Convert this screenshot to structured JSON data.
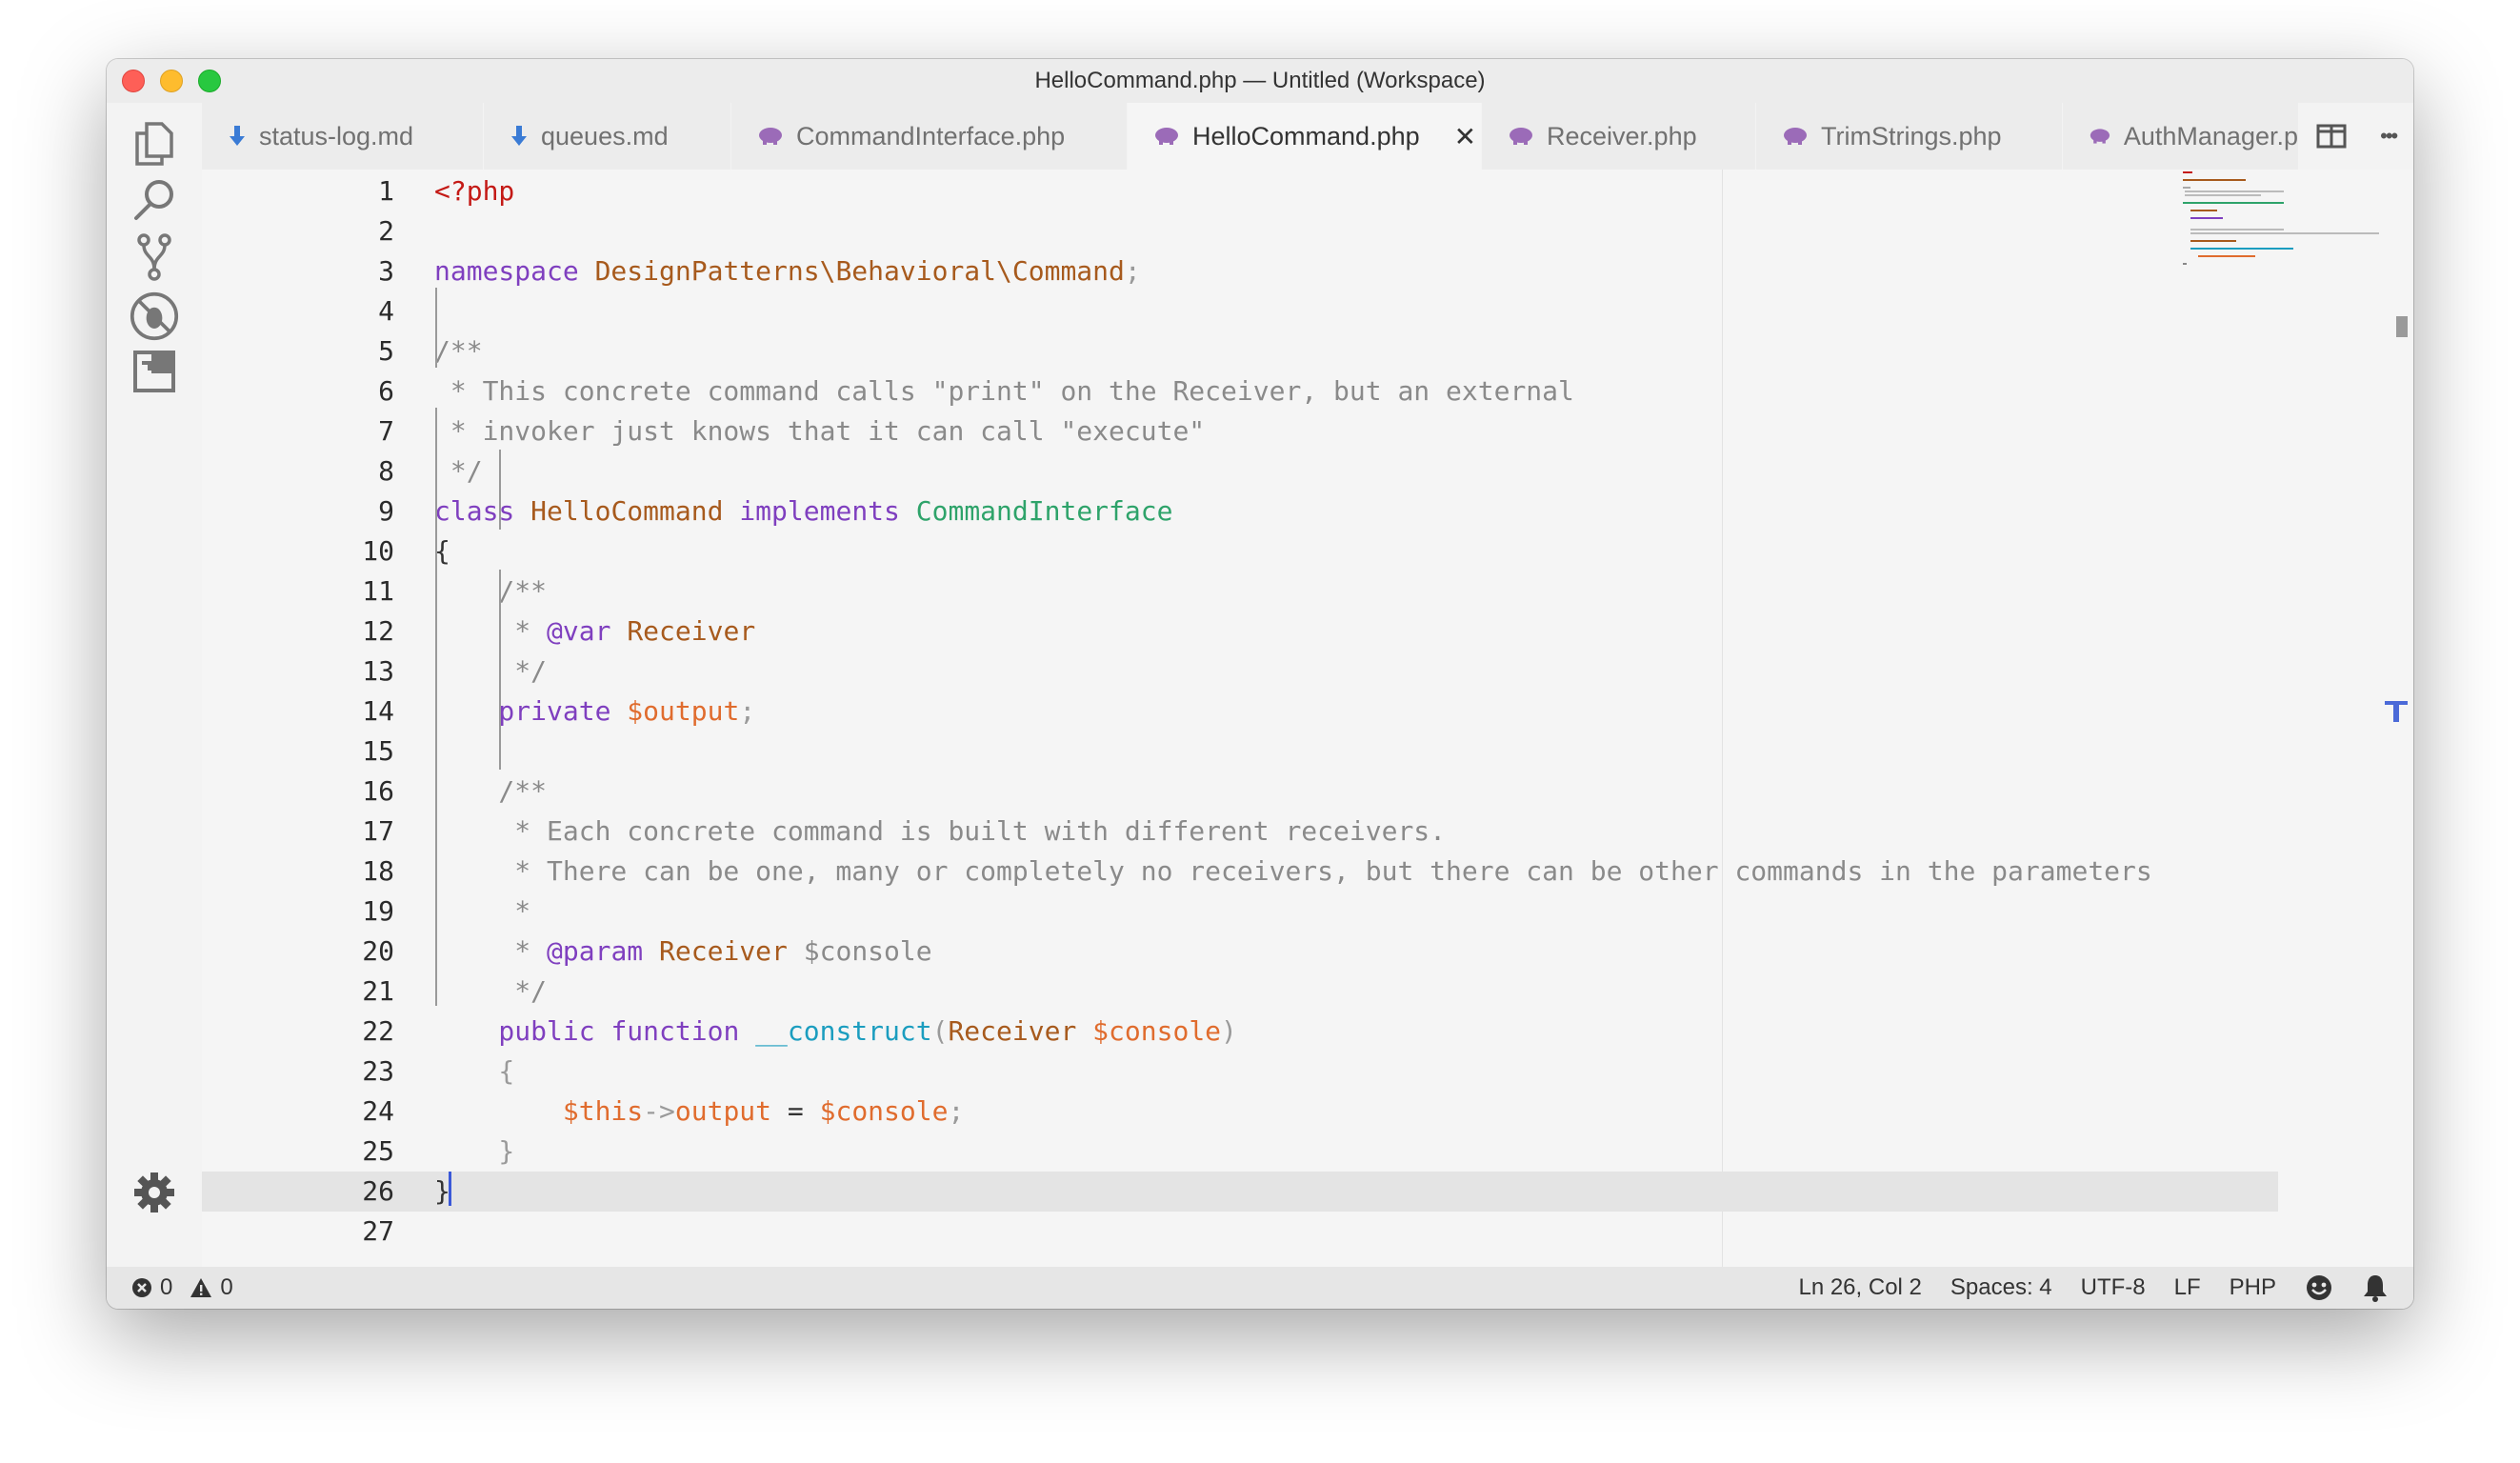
{
  "window": {
    "title": "HelloCommand.php — Untitled (Workspace)"
  },
  "activity_bar": {
    "items": [
      {
        "icon": "files-icon"
      },
      {
        "icon": "search-icon"
      },
      {
        "icon": "source-control-icon"
      },
      {
        "icon": "debug-icon"
      },
      {
        "icon": "extensions-icon"
      }
    ],
    "settings_icon": "gear-icon"
  },
  "tabs": [
    {
      "label": "status-log.md",
      "icon": "markdown-icon",
      "active": false
    },
    {
      "label": "queues.md",
      "icon": "markdown-icon",
      "active": false
    },
    {
      "label": "CommandInterface.php",
      "icon": "php-icon",
      "active": false
    },
    {
      "label": "HelloCommand.php",
      "icon": "php-icon",
      "active": true,
      "close": "✕"
    },
    {
      "label": "Receiver.php",
      "icon": "php-icon",
      "active": false
    },
    {
      "label": "TrimStrings.php",
      "icon": "php-icon",
      "active": false
    },
    {
      "label": "AuthManager.p",
      "icon": "php-icon",
      "active": false
    }
  ],
  "tab_actions": {
    "split": "split-editor-icon",
    "more": "•••"
  },
  "editor": {
    "language": "PHP",
    "current_line": 26,
    "lines": [
      {
        "n": "1",
        "tokens": [
          [
            "<?php",
            "tag"
          ]
        ]
      },
      {
        "n": "2",
        "tokens": []
      },
      {
        "n": "3",
        "tokens": [
          [
            "namespace ",
            "kw"
          ],
          [
            "DesignPatterns\\Behavioral\\Command",
            "ns"
          ],
          [
            ";",
            "punct"
          ]
        ]
      },
      {
        "n": "4",
        "tokens": []
      },
      {
        "n": "5",
        "tokens": [
          [
            "/**",
            "cm"
          ]
        ]
      },
      {
        "n": "6",
        "tokens": [
          [
            " * This concrete command calls \"print\" on the Receiver, but an external",
            "cm"
          ]
        ]
      },
      {
        "n": "7",
        "tokens": [
          [
            " * invoker just knows that it can call \"execute\"",
            "cm"
          ]
        ]
      },
      {
        "n": "8",
        "tokens": [
          [
            " */",
            "cm"
          ]
        ]
      },
      {
        "n": "9",
        "tokens": [
          [
            "class ",
            "kw"
          ],
          [
            "HelloCommand ",
            "ns"
          ],
          [
            "implements ",
            "kw"
          ],
          [
            "CommandInterface",
            "iface"
          ]
        ]
      },
      {
        "n": "10",
        "tokens": [
          [
            "{",
            "plain"
          ]
        ]
      },
      {
        "n": "11",
        "tokens": [
          [
            "    /**",
            "cm"
          ]
        ]
      },
      {
        "n": "12",
        "tokens": [
          [
            "     * ",
            "cm"
          ],
          [
            "@var ",
            "kw"
          ],
          [
            "Receiver",
            "ns"
          ]
        ]
      },
      {
        "n": "13",
        "tokens": [
          [
            "     */",
            "cm"
          ]
        ]
      },
      {
        "n": "14",
        "tokens": [
          [
            "    private ",
            "kw"
          ],
          [
            "$output",
            "var"
          ],
          [
            ";",
            "punct"
          ]
        ]
      },
      {
        "n": "15",
        "tokens": []
      },
      {
        "n": "16",
        "tokens": [
          [
            "    /**",
            "cm"
          ]
        ]
      },
      {
        "n": "17",
        "tokens": [
          [
            "     * Each concrete command is built with different receivers.",
            "cm"
          ]
        ]
      },
      {
        "n": "18",
        "tokens": [
          [
            "     * There can be one, many or completely no receivers, but there can be other commands in the parameters",
            "cm"
          ]
        ]
      },
      {
        "n": "19",
        "tokens": [
          [
            "     *",
            "cm"
          ]
        ]
      },
      {
        "n": "20",
        "tokens": [
          [
            "     * ",
            "cm"
          ],
          [
            "@param ",
            "kw"
          ],
          [
            "Receiver ",
            "ns"
          ],
          [
            "$console",
            "cm"
          ]
        ]
      },
      {
        "n": "21",
        "tokens": [
          [
            "     */",
            "cm"
          ]
        ]
      },
      {
        "n": "22",
        "tokens": [
          [
            "    public ",
            "kw"
          ],
          [
            "function ",
            "kw"
          ],
          [
            "__construct",
            "fn"
          ],
          [
            "(",
            "punct"
          ],
          [
            "Receiver ",
            "ns"
          ],
          [
            "$console",
            "var"
          ],
          [
            ")",
            "punct"
          ]
        ]
      },
      {
        "n": "23",
        "tokens": [
          [
            "    {",
            "punct"
          ]
        ]
      },
      {
        "n": "24",
        "tokens": [
          [
            "        $this",
            "var"
          ],
          [
            "->",
            "punct"
          ],
          [
            "output",
            "var"
          ],
          [
            " = ",
            "plain"
          ],
          [
            "$console",
            "var"
          ],
          [
            ";",
            "punct"
          ]
        ]
      },
      {
        "n": "25",
        "tokens": [
          [
            "    }",
            "punct"
          ]
        ]
      },
      {
        "n": "26",
        "tokens": [
          [
            "}",
            "plain"
          ]
        ]
      },
      {
        "n": "27",
        "tokens": []
      }
    ]
  },
  "status_bar": {
    "errors": "0",
    "warnings": "0",
    "position": "Ln 26, Col 2",
    "spaces": "Spaces: 4",
    "encoding": "UTF-8",
    "eol": "LF",
    "language": "PHP"
  }
}
